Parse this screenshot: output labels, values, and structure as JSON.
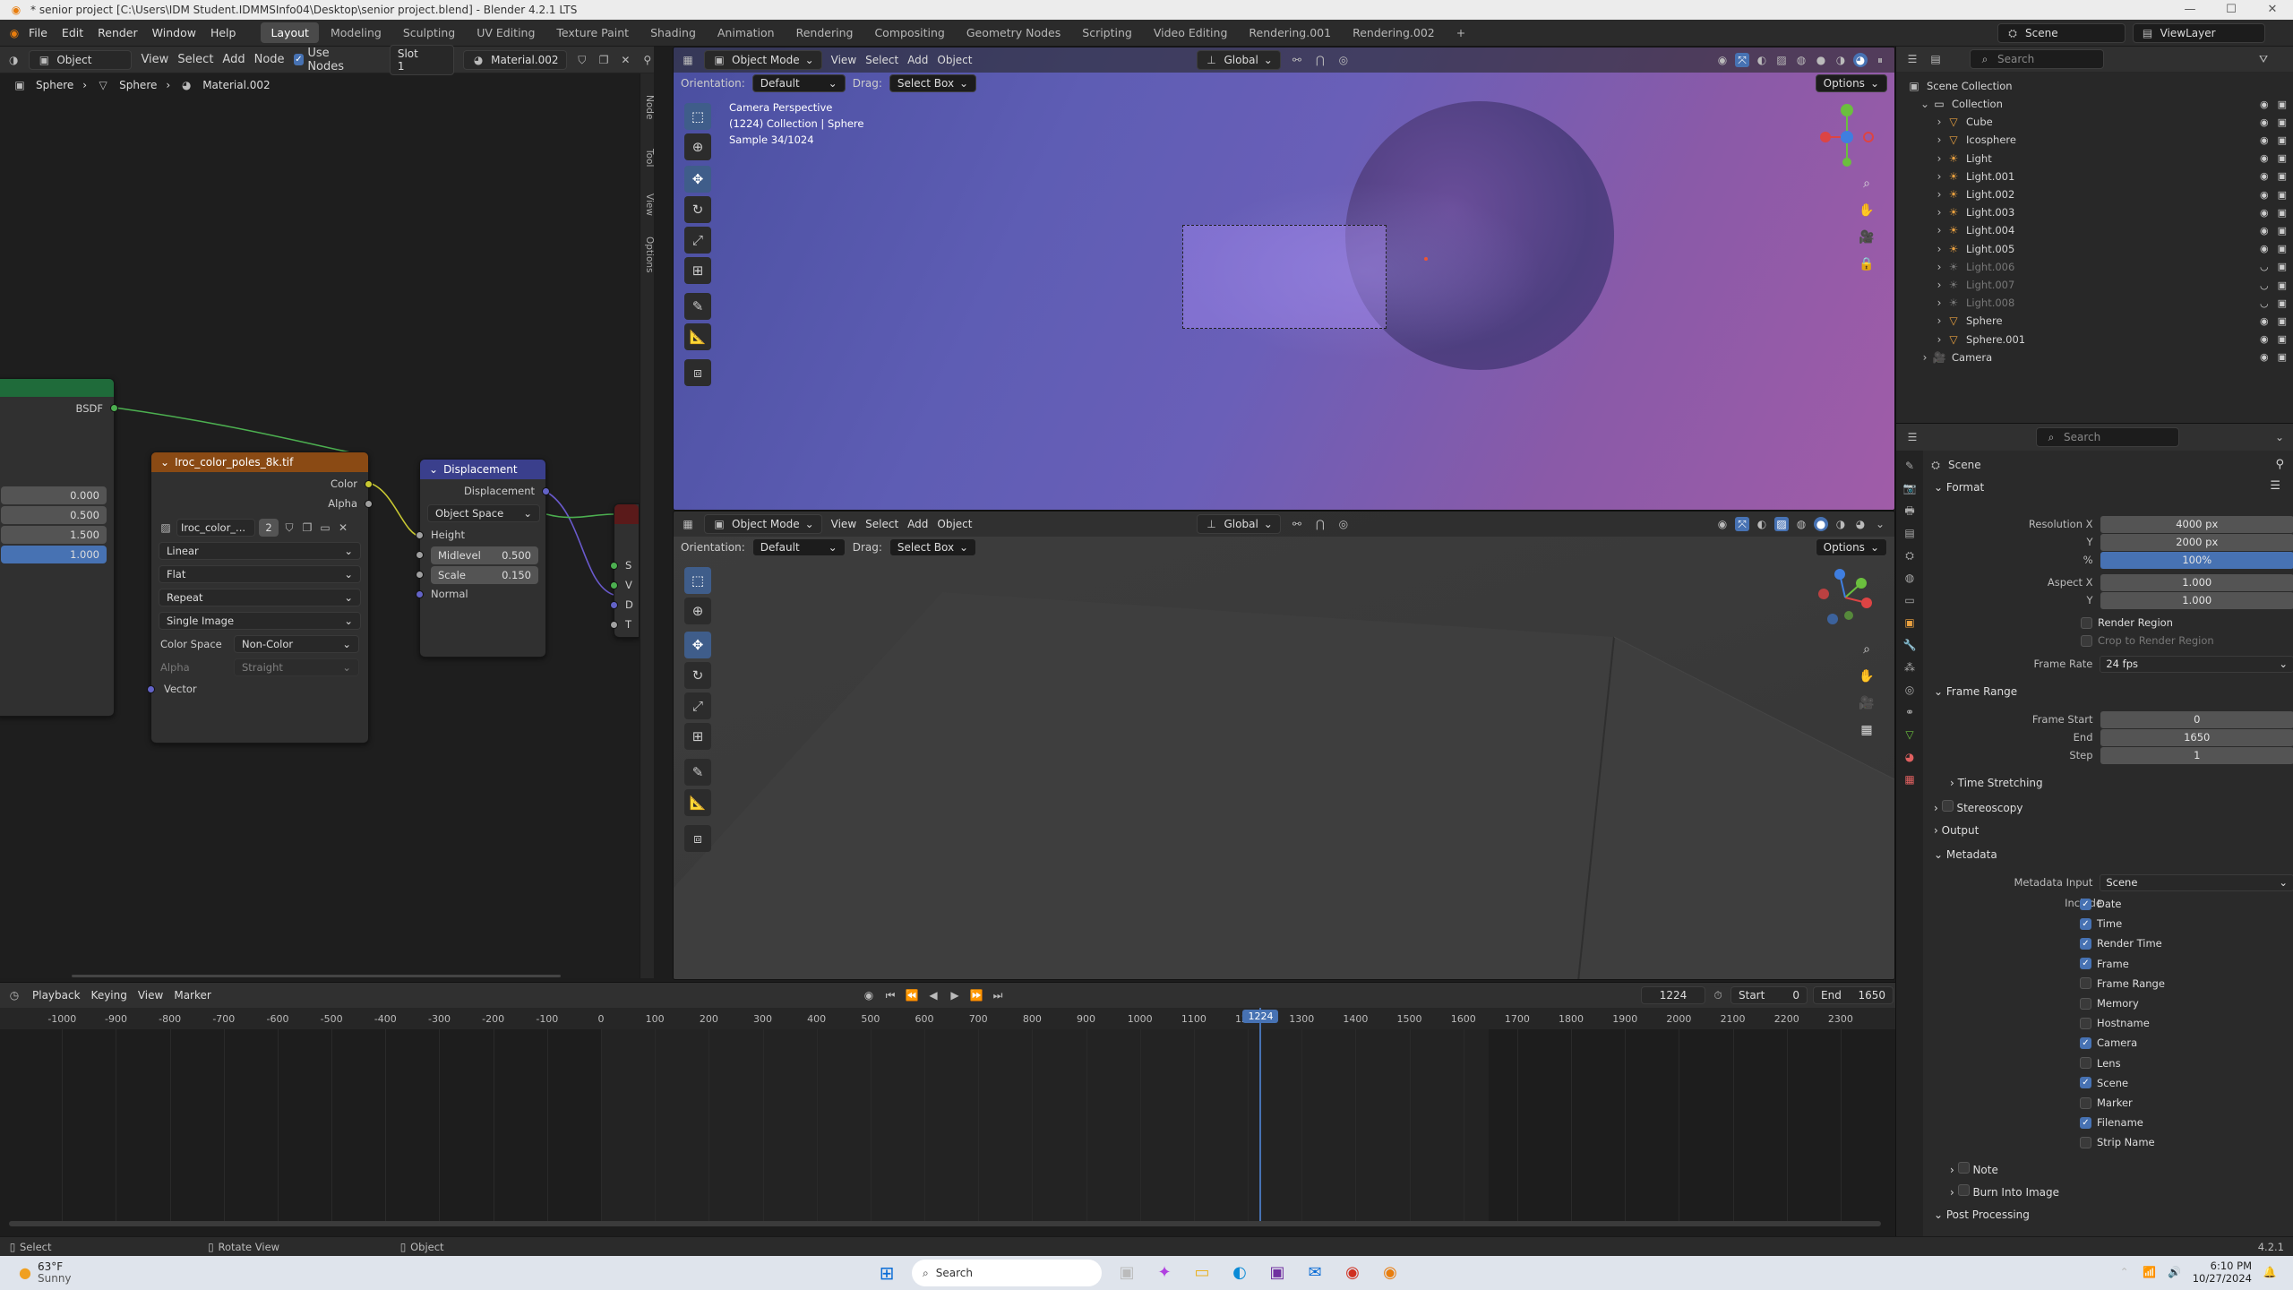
{
  "window": {
    "title": "* senior project [C:\\Users\\IDM Student.IDMMSInfo04\\Desktop\\senior project.blend] - Blender 4.2.1 LTS"
  },
  "menu": [
    "File",
    "Edit",
    "Render",
    "Window",
    "Help"
  ],
  "workspaces": [
    "Layout",
    "Modeling",
    "Sculpting",
    "UV Editing",
    "Texture Paint",
    "Shading",
    "Animation",
    "Rendering",
    "Compositing",
    "Geometry Nodes",
    "Scripting",
    "Video Editing",
    "Rendering.001",
    "Rendering.002"
  ],
  "active_workspace": "Layout",
  "scene_name": "Scene",
  "view_layer": "ViewLayer",
  "node_editor": {
    "object_mode": "Object",
    "menus": [
      "View",
      "Select",
      "Add",
      "Node"
    ],
    "use_nodes": "Use Nodes",
    "slot": "Slot 1",
    "material": "Material.002",
    "breadcrumb": [
      "Sphere",
      "Sphere",
      "Material.002"
    ],
    "side_tabs": [
      "Node",
      "Tool",
      "View",
      "Options"
    ],
    "left_node": {
      "output": "BSDF",
      "values": [
        "0.000",
        "0.500",
        "1.500",
        "1.000"
      ]
    },
    "image_node": {
      "title": "Iroc_color_poles_8k.tif",
      "out_color": "Color",
      "out_alpha": "Alpha",
      "image_name": "Iroc_color_...",
      "users": "2",
      "interpolation": "Linear",
      "projection": "Flat",
      "extension": "Repeat",
      "source": "Single Image",
      "color_space_label": "Color Space",
      "color_space": "Non-Color",
      "alpha_label": "Alpha",
      "alpha": "Straight",
      "vector": "Vector"
    },
    "disp_node": {
      "title": "Displacement",
      "output": "Displacement",
      "space": "Object Space",
      "height": "Height",
      "midlevel_label": "Midlevel",
      "midlevel": "0.500",
      "scale_label": "Scale",
      "scale": "0.150",
      "normal": "Normal"
    },
    "right_sockets": [
      "S",
      "V",
      "D",
      "T"
    ]
  },
  "viewport_top": {
    "mode": "Object Mode",
    "menus": [
      "View",
      "Select",
      "Add",
      "Object"
    ],
    "transform": "Global",
    "orientation_label": "Orientation:",
    "orientation": "Default",
    "drag_label": "Drag:",
    "drag": "Select Box",
    "options": "Options",
    "info": [
      "Camera Perspective",
      "(1224) Collection | Sphere",
      "Sample 34/1024"
    ]
  },
  "viewport_bottom": {
    "mode": "Object Mode",
    "menus": [
      "View",
      "Select",
      "Add",
      "Object"
    ],
    "transform": "Global",
    "orientation_label": "Orientation:",
    "orientation": "Default",
    "drag_label": "Drag:",
    "drag": "Select Box",
    "options": "Options"
  },
  "outliner": {
    "search": "Search",
    "root": "Scene Collection",
    "items": [
      {
        "name": "Collection",
        "dim": false,
        "type": "collection"
      },
      {
        "name": "Cube",
        "dim": false,
        "type": "mesh"
      },
      {
        "name": "Icosphere",
        "dim": false,
        "type": "mesh"
      },
      {
        "name": "Light",
        "dim": false,
        "type": "light"
      },
      {
        "name": "Light.001",
        "dim": false,
        "type": "light"
      },
      {
        "name": "Light.002",
        "dim": false,
        "type": "light"
      },
      {
        "name": "Light.003",
        "dim": false,
        "type": "light"
      },
      {
        "name": "Light.004",
        "dim": false,
        "type": "light"
      },
      {
        "name": "Light.005",
        "dim": false,
        "type": "light"
      },
      {
        "name": "Light.006",
        "dim": true,
        "type": "light"
      },
      {
        "name": "Light.007",
        "dim": true,
        "type": "light"
      },
      {
        "name": "Light.008",
        "dim": true,
        "type": "light"
      },
      {
        "name": "Sphere",
        "dim": false,
        "type": "mesh"
      },
      {
        "name": "Sphere.001",
        "dim": false,
        "type": "mesh"
      },
      {
        "name": "Camera",
        "dim": false,
        "type": "camera"
      }
    ]
  },
  "properties": {
    "search": "Search",
    "context": "Scene",
    "format": {
      "title": "Format",
      "res_x_label": "Resolution X",
      "res_x": "4000 px",
      "res_y_label": "Y",
      "res_y": "2000 px",
      "pct_label": "%",
      "pct": "100%",
      "aspect_x_label": "Aspect X",
      "aspect_x": "1.000",
      "aspect_y_label": "Y",
      "aspect_y": "1.000",
      "render_region": "Render Region",
      "crop": "Crop to Render Region",
      "frame_rate_label": "Frame Rate",
      "frame_rate": "24 fps"
    },
    "frame_range": {
      "title": "Frame Range",
      "start_label": "Frame Start",
      "start": "0",
      "end_label": "End",
      "end": "1650",
      "step_label": "Step",
      "step": "1"
    },
    "time_stretching": "Time Stretching",
    "stereoscopy": "Stereoscopy",
    "output": "Output",
    "metadata": {
      "title": "Metadata",
      "input_label": "Metadata Input",
      "input": "Scene",
      "include": "Include",
      "items": [
        {
          "label": "Date",
          "on": true
        },
        {
          "label": "Time",
          "on": true
        },
        {
          "label": "Render Time",
          "on": true
        },
        {
          "label": "Frame",
          "on": true
        },
        {
          "label": "Frame Range",
          "on": false
        },
        {
          "label": "Memory",
          "on": false
        },
        {
          "label": "Hostname",
          "on": false
        },
        {
          "label": "Camera",
          "on": true
        },
        {
          "label": "Lens",
          "on": false
        },
        {
          "label": "Scene",
          "on": true
        },
        {
          "label": "Marker",
          "on": false
        },
        {
          "label": "Filename",
          "on": true
        },
        {
          "label": "Strip Name",
          "on": false
        }
      ]
    },
    "note": "Note",
    "burn": "Burn Into Image",
    "post": "Post Processing"
  },
  "timeline": {
    "menus": [
      "Playback",
      "Keying",
      "View",
      "Marker"
    ],
    "current_frame": "1224",
    "start_label": "Start",
    "start": "0",
    "end_label": "End",
    "end": "1650",
    "ticks": [
      "-1000",
      "-900",
      "-800",
      "-700",
      "-600",
      "-500",
      "-400",
      "-300",
      "-200",
      "-100",
      "0",
      "100",
      "200",
      "300",
      "400",
      "500",
      "600",
      "700",
      "800",
      "900",
      "1000",
      "1100",
      "1200",
      "1300",
      "1400",
      "1500",
      "1600",
      "1700",
      "1800",
      "1900",
      "2000",
      "2100",
      "2200",
      "2300"
    ],
    "playhead": "1224"
  },
  "status": {
    "select": "Select",
    "rotate": "Rotate View",
    "object": "Object",
    "version": "4.2.1"
  },
  "taskbar": {
    "temp": "63°F",
    "weather": "Sunny",
    "search": "Search",
    "time": "6:10 PM",
    "date": "10/27/2024"
  },
  "colors": {
    "accent": "#4772b3",
    "image_node": "#8a4a14",
    "disp_node": "#3a3f8c",
    "bsdf_node": "#1f6b3a"
  }
}
